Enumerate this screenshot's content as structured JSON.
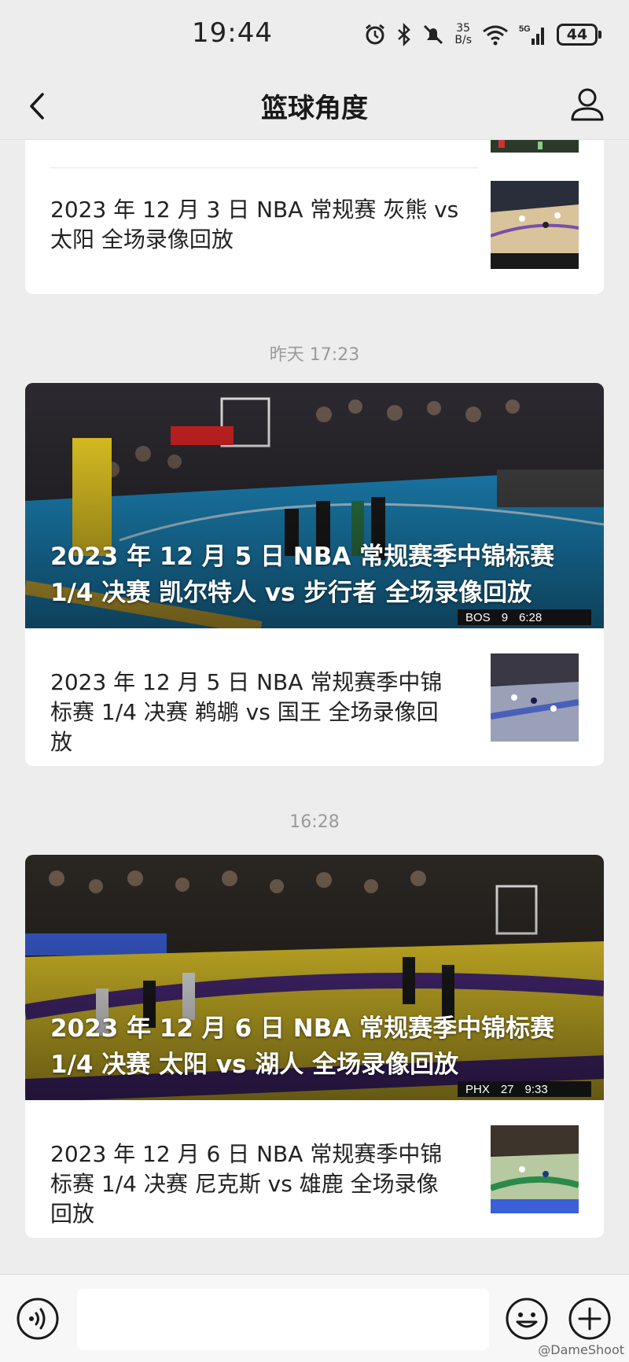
{
  "status_bar": {
    "time": "19:44",
    "net_speed_value": "35",
    "net_speed_unit": "B/s",
    "signal_label": "5G",
    "wifi_label": "6",
    "battery": "44"
  },
  "nav": {
    "title": "篮球角度",
    "back_icon": "chevron-left-icon",
    "profile_icon": "person-icon"
  },
  "feed": [
    {
      "timestamp": "",
      "cover_title": "",
      "items": [
        {
          "title": "2023 年 12 月 3 日 NBA 常规赛 灰熊 vs 太阳 全场录像回放"
        }
      ]
    },
    {
      "timestamp": "昨天 17:23",
      "cover_title": "2023 年 12 月 5 日 NBA 常规赛季中锦标赛 1/4 决赛 凯尔特人 vs 步行者 全场录像回放",
      "cover_score": {
        "team": "BOS",
        "score": "9",
        "clock": "6:28"
      },
      "items": [
        {
          "title": "2023 年 12 月 5 日 NBA 常规赛季中锦标赛 1/4 决赛 鹈鹕 vs 国王 全场录像回放"
        }
      ]
    },
    {
      "timestamp": "16:28",
      "cover_title": "2023 年 12 月 6 日 NBA 常规赛季中锦标赛 1/4 决赛 太阳 vs 湖人 全场录像回放",
      "cover_score": {
        "team": "PHX",
        "score": "27",
        "clock": "9:33"
      },
      "items": [
        {
          "title": "2023 年 12 月 6 日 NBA 常规赛季中锦标赛 1/4 决赛 尼克斯 vs 雄鹿 全场录像回放"
        }
      ]
    }
  ],
  "input_bar": {
    "voice_icon": "voice-icon",
    "emoji_icon": "emoji-icon",
    "plus_icon": "plus-icon"
  },
  "watermark": "@DameShoot",
  "colors": {
    "background": "#ededed",
    "card": "#ffffff",
    "timestamp": "#9a9a9a",
    "court_blue": "#1e8fc8",
    "court_yellow": "#e0c52a"
  }
}
